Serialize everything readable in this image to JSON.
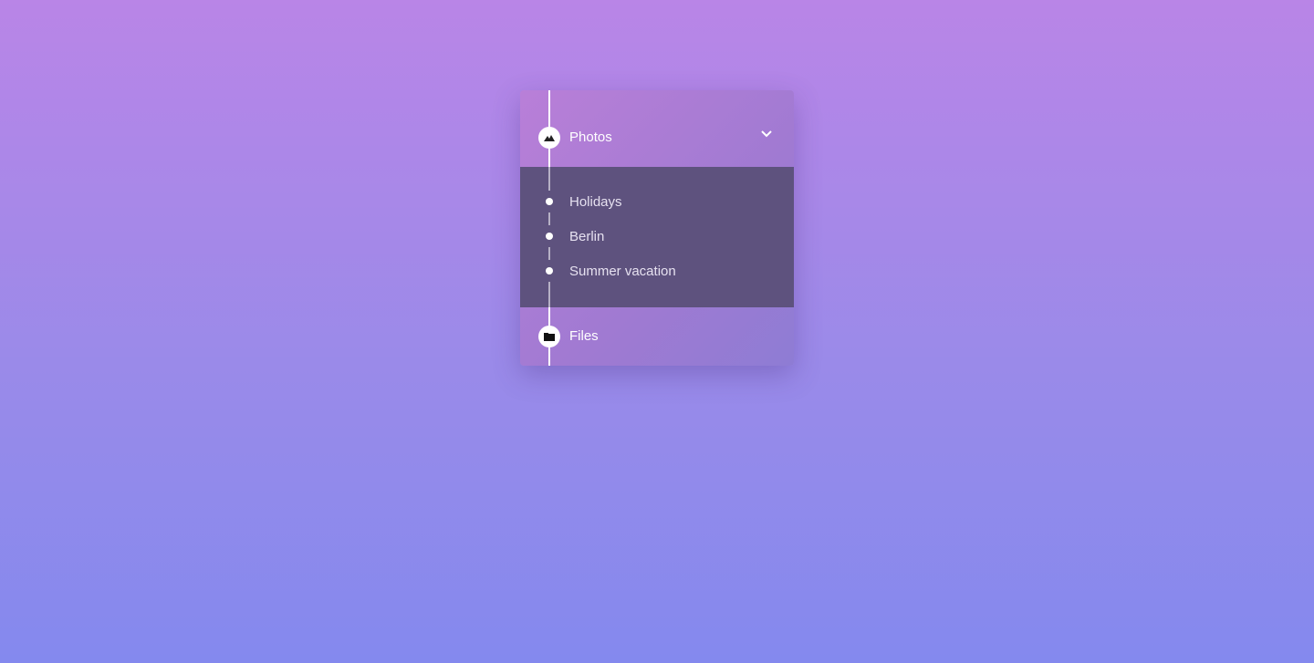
{
  "menu": {
    "photos": {
      "label": "Photos",
      "icon": "mountain-icon",
      "expanded": true
    },
    "subitems": [
      {
        "label": "Holidays"
      },
      {
        "label": "Berlin"
      },
      {
        "label": "Summer vacation"
      }
    ],
    "files": {
      "label": "Files",
      "icon": "folder-icon"
    }
  },
  "colors": {
    "submenu_bg": "#5e527e",
    "accent": "#ffffff"
  }
}
